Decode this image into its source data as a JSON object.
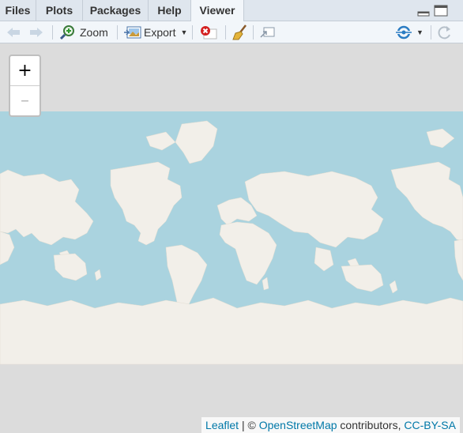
{
  "tabs": [
    {
      "label": "Files"
    },
    {
      "label": "Plots"
    },
    {
      "label": "Packages"
    },
    {
      "label": "Help"
    },
    {
      "label": "Viewer"
    }
  ],
  "active_tab": "Viewer",
  "toolbar": {
    "zoom_label": "Zoom",
    "export_label": "Export"
  },
  "map": {
    "zoom_in_label": "+",
    "zoom_out_label": "–",
    "attribution": {
      "leaflet": "Leaflet",
      "sep": " | © ",
      "osm": "OpenStreetMap",
      "contributors": " contributors, ",
      "license": "CC-BY-SA"
    },
    "colors": {
      "ocean": "#aad3df",
      "land": "#f2efe9",
      "background": "#dcdcdc"
    }
  }
}
